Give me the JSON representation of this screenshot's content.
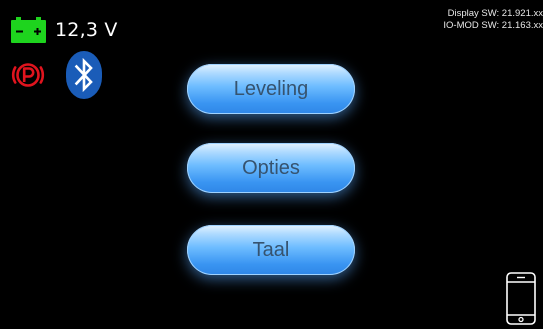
{
  "status": {
    "voltage": "12,3 V",
    "battery_icon": "battery-icon",
    "parking_icon": "parking-brake-icon",
    "bluetooth_icon": "bluetooth-icon"
  },
  "info": {
    "display_sw": "Display SW: 21.921.xx",
    "iomod_sw": "IO-MOD SW: 21.163.xx"
  },
  "menu": {
    "items": [
      {
        "label": "Leveling"
      },
      {
        "label": "Opties"
      },
      {
        "label": "Taal"
      }
    ]
  },
  "device": {
    "phone_icon": "phone-icon"
  },
  "colors": {
    "background": "#000000",
    "battery": "#1ed41e",
    "parking": "#e0141e",
    "bluetooth": "#1a5cb8",
    "button_top": "#e4f3ff",
    "button_bottom": "#2f86e6",
    "button_text": "#36536f"
  }
}
